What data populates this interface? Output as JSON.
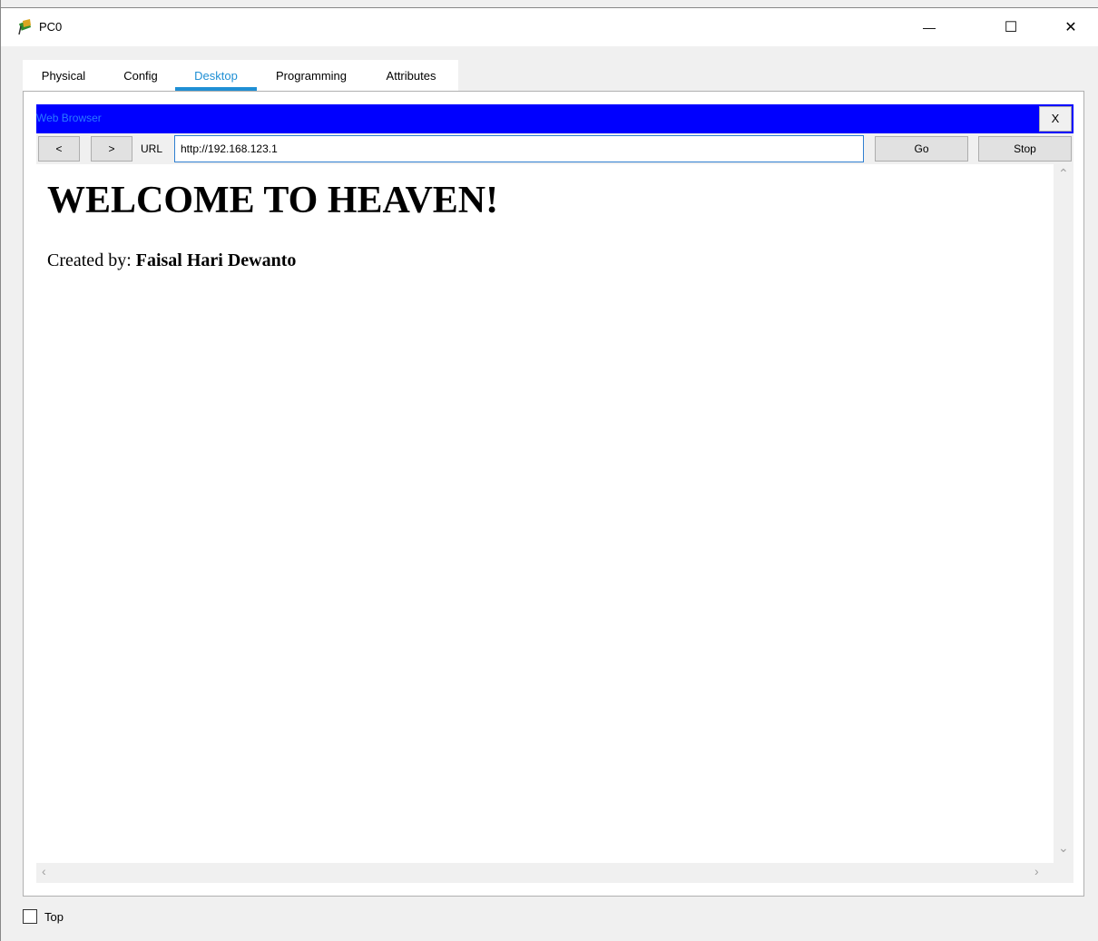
{
  "window": {
    "title": "PC0",
    "minimize_glyph": "—",
    "maximize_glyph": "☐",
    "close_glyph": "✕"
  },
  "tabs": [
    {
      "label": "Physical"
    },
    {
      "label": "Config"
    },
    {
      "label": "Desktop"
    },
    {
      "label": "Programming"
    },
    {
      "label": "Attributes"
    }
  ],
  "web_browser": {
    "title": "Web Browser",
    "close_label": "X",
    "back_label": "<",
    "forward_label": ">",
    "url_label": "URL",
    "url_value": "http://192.168.123.1",
    "go_label": "Go",
    "stop_label": "Stop"
  },
  "page": {
    "heading": "WELCOME TO HEAVEN!",
    "created_prefix": "Created by: ",
    "author": "Faisal Hari Dewanto"
  },
  "footer": {
    "top_label": "Top"
  },
  "colors": {
    "accent": "#1f8fd4",
    "browser_header": "#0000ff"
  }
}
